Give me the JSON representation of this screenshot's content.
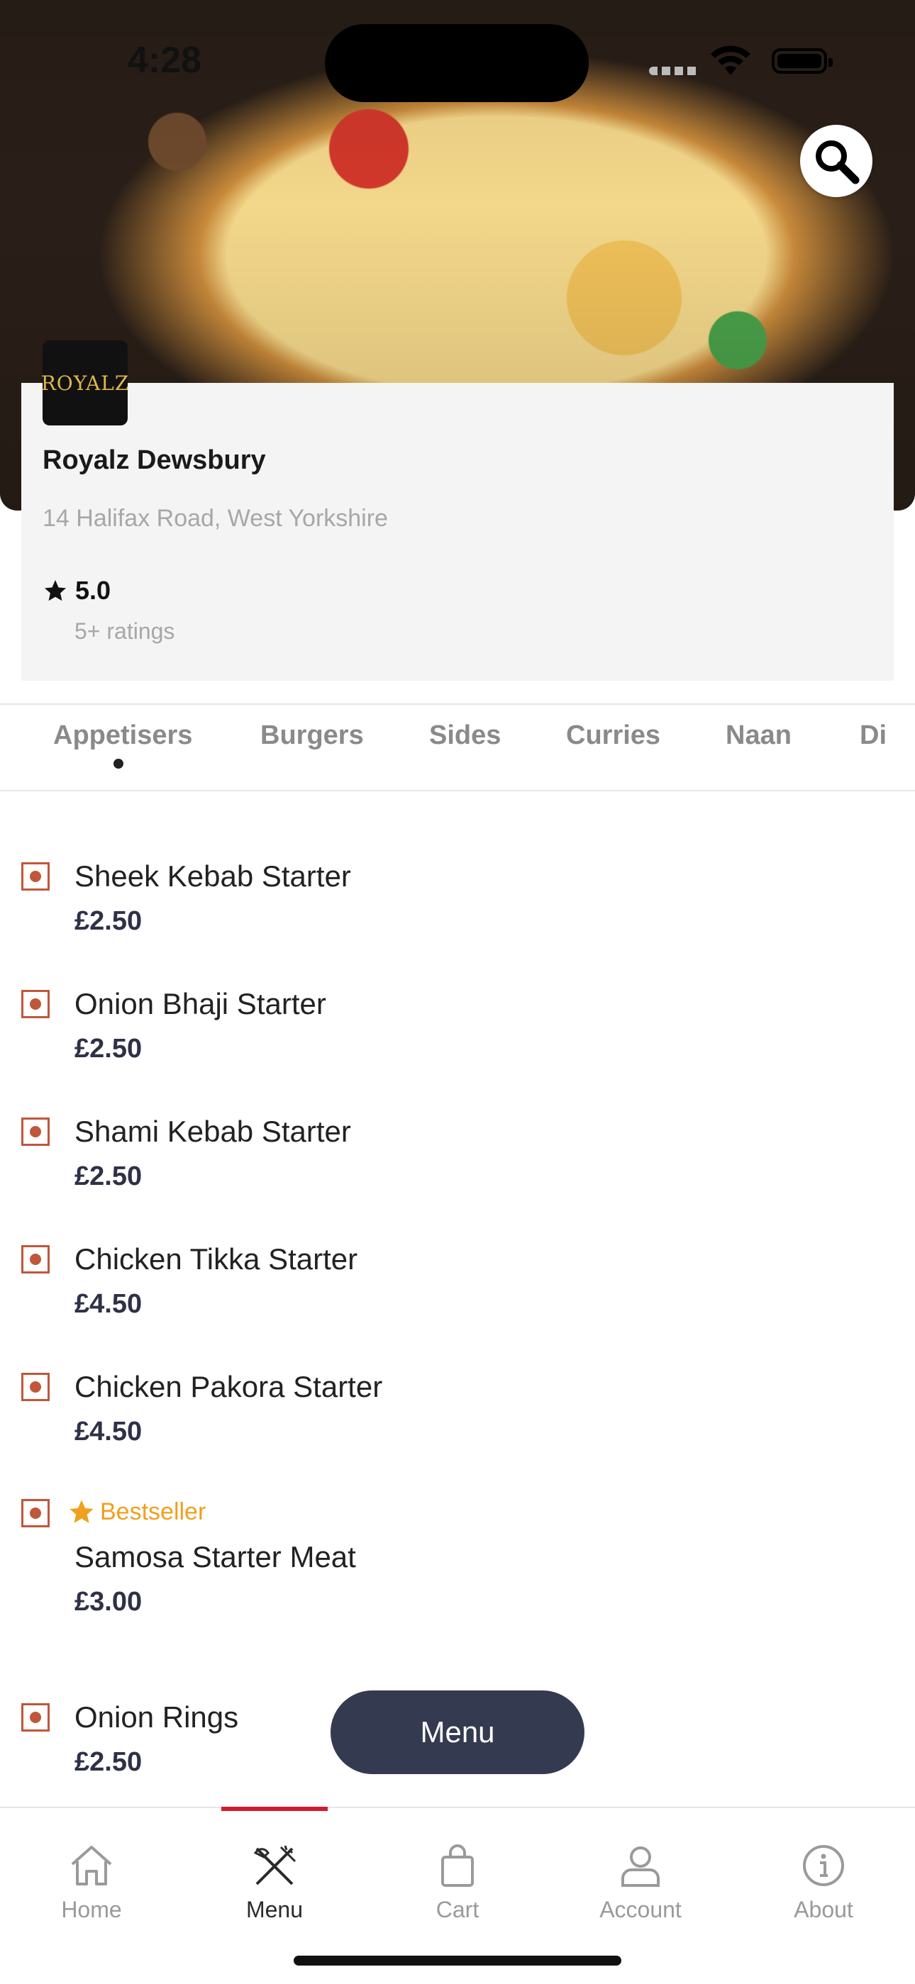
{
  "status_bar": {
    "time": "4:28"
  },
  "restaurant": {
    "logo_text": "ROYALZ",
    "name": "Royalz Dewsbury",
    "address": "14 Halifax Road, West Yorkshire",
    "rating": "5.0",
    "rating_count": "5+ ratings"
  },
  "categories": {
    "items": [
      "Appetisers",
      "Burgers",
      "Sides",
      "Curries",
      "Naan",
      "Di"
    ],
    "active": "Appetisers"
  },
  "menu_items": [
    {
      "name": "Sheek Kebab Starter",
      "price": "£2.50"
    },
    {
      "name": "Onion Bhaji Starter",
      "price": "£2.50"
    },
    {
      "name": "Shami Kebab Starter",
      "price": "£2.50"
    },
    {
      "name": "Chicken Tikka Starter",
      "price": "£4.50"
    },
    {
      "name": "Chicken Pakora Starter",
      "price": "£4.50"
    },
    {
      "name": "Samosa Starter Meat",
      "price": "£3.00",
      "badge": "Bestseller"
    },
    {
      "name": "Onion Rings",
      "price": "£2.50"
    }
  ],
  "floating_button": {
    "label": "Menu"
  },
  "bottom_nav": {
    "items": [
      {
        "label": "Home",
        "icon": "home-icon"
      },
      {
        "label": "Menu",
        "icon": "fork-knife-icon"
      },
      {
        "label": "Cart",
        "icon": "bag-icon"
      },
      {
        "label": "Account",
        "icon": "person-icon"
      },
      {
        "label": "About",
        "icon": "info-icon"
      }
    ],
    "active": "Menu"
  },
  "colors": {
    "accent_red": "#d6182b",
    "bestseller": "#f0a01e",
    "price": "#2e3147",
    "veg_marker": "#c0573a",
    "pill": "#343a4f"
  }
}
